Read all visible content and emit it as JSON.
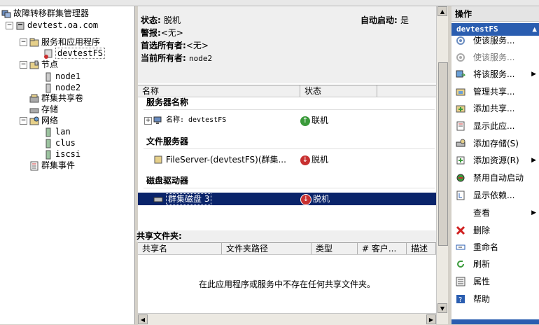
{
  "tree": {
    "root": "故障转移群集管理器",
    "cluster": "devtest.oa.com",
    "services": "服务和应用程序",
    "service_item": "devtestFS",
    "nodes": "节点",
    "node1": "node1",
    "node2": "node2",
    "shared_volumes": "群集共享卷",
    "storage": "存储",
    "network": "网络",
    "net_lan": "lan",
    "net_clus": "clus",
    "net_iscsi": "iscsi",
    "events": "群集事件"
  },
  "summary": {
    "status_label": "状态:",
    "status_value": "脱机",
    "autostart_label": "自动启动:",
    "autostart_value": "是",
    "alert_label": "警报:",
    "alert_value": "<无>",
    "preferred_label": "首选所有者:",
    "preferred_value": "<无>",
    "current_label": "当前所有者:",
    "current_value": "node2"
  },
  "resources": {
    "col_name": "名称",
    "col_status": "状态",
    "group_server": "服务器名称",
    "server_row": "名称: devtestFS",
    "server_status": "联机",
    "group_file": "文件服务器",
    "file_row": "FileServer-(devtestFS)(群集...",
    "file_status": "脱机",
    "group_disk": "磁盘驱动器",
    "disk_row": "群集磁盘 3",
    "disk_status": "脱机"
  },
  "shares": {
    "header": "共享文件夹:",
    "cols": [
      "共享名",
      "文件夹路径",
      "类型",
      "# 客户...",
      "描述"
    ],
    "empty": "在此应用程序或服务中不存在任何共享文件夹。"
  },
  "actions": {
    "header": "操作",
    "subheader": "devtestFS",
    "items": [
      {
        "label": "使该服务...",
        "disabled": false,
        "arrow": false
      },
      {
        "label": "使该服务...",
        "disabled": true,
        "arrow": false
      },
      {
        "label": "将该服务...",
        "disabled": false,
        "arrow": true
      },
      {
        "label": "管理共享...",
        "disabled": false,
        "arrow": false
      },
      {
        "label": "添加共享...",
        "disabled": false,
        "arrow": false
      },
      {
        "label": "显示此应...",
        "disabled": false,
        "arrow": false
      },
      {
        "label": "添加存储(S)",
        "disabled": false,
        "arrow": false
      },
      {
        "label": "添加资源(R)",
        "disabled": false,
        "arrow": true
      },
      {
        "label": "禁用自动启动",
        "disabled": false,
        "arrow": false
      },
      {
        "label": "显示依赖...",
        "disabled": false,
        "arrow": false
      },
      {
        "label": "查看",
        "disabled": false,
        "arrow": true
      },
      {
        "label": "删除",
        "disabled": false,
        "arrow": false
      },
      {
        "label": "重命名",
        "disabled": false,
        "arrow": false
      },
      {
        "label": "刷新",
        "disabled": false,
        "arrow": false
      },
      {
        "label": "属性",
        "disabled": false,
        "arrow": false
      },
      {
        "label": "帮助",
        "disabled": false,
        "arrow": false
      }
    ]
  },
  "colors": {
    "selection": "#0a246a",
    "action_header": "#2a5db0",
    "online": "#3a9a3a",
    "offline": "#c83030"
  }
}
